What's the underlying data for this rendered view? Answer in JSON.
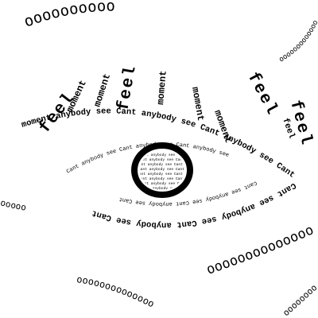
{
  "artwork": {
    "lashes": [
      {
        "text": "feel",
        "kind": "feel"
      },
      {
        "text": "moment",
        "kind": "moment"
      },
      {
        "text": "moment",
        "kind": "moment"
      },
      {
        "text": "feel",
        "kind": "feel"
      },
      {
        "text": "moment",
        "kind": "moment"
      },
      {
        "text": "moment",
        "kind": "moment"
      },
      {
        "text": "moment",
        "kind": "moment"
      },
      {
        "text": "feel",
        "kind": "feel"
      },
      {
        "text": "feel",
        "kind": "feel"
      }
    ],
    "upper_lid_text": "moment anybody see Cant anybody see Cant anybody see Cant",
    "right_lid_text": "feel",
    "lower_lid_text": "Cant see anybody see Cant anybody see Cant",
    "inner_upper_text": "Cant anybody see Cant anybody see Cant anybody see",
    "inner_lower_text": "Cant see anybody see Cant anybody see Cant",
    "iris_text": "Cant anybody see Cant anybody see Cant anybody see",
    "o_streams": [
      {
        "text": "oooooooooo"
      },
      {
        "text": "ooooooooooooo"
      },
      {
        "text": "oooooooooooooo"
      },
      {
        "text": "oooooooooooooo"
      },
      {
        "text": "oooooooooooooo"
      },
      {
        "text": "oooooooo"
      }
    ],
    "colors": {
      "ink": "#000000",
      "paper": "#ffffff"
    }
  }
}
